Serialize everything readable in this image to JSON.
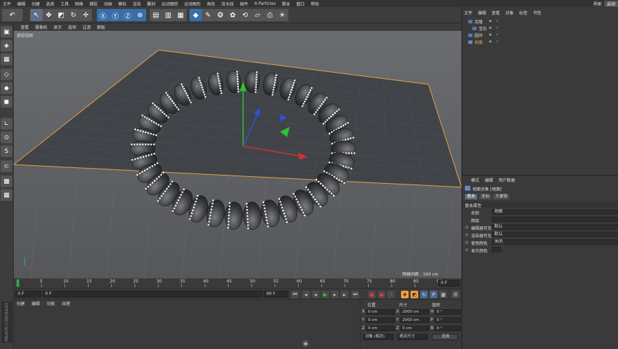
{
  "menubar": {
    "items": [
      "文件",
      "编辑",
      "创建",
      "选择",
      "工具",
      "网格",
      "捕捉",
      "动画",
      "模拟",
      "渲染",
      "雕刻",
      "运动跟踪",
      "运动图形",
      "角色",
      "流水线",
      "插件",
      "X-Particles",
      "脚本",
      "窗口",
      "帮助"
    ],
    "layout_label": "界面",
    "layout_value": "启动"
  },
  "viewport": {
    "menu": [
      "查看",
      "摄像机",
      "显示",
      "选项",
      "过滤",
      "面板"
    ],
    "view_label": "透视视图",
    "grid_spacing": "网格间距 : 100 cm"
  },
  "timeline": {
    "ticks": [
      "0",
      "5",
      "10",
      "15",
      "20",
      "25",
      "30",
      "35",
      "40",
      "45",
      "50",
      "55",
      "60",
      "65",
      "70",
      "75",
      "80",
      "85",
      "90"
    ],
    "end_frame": "0 F"
  },
  "transport": {
    "current_frame": "0 F",
    "min_frame": "0 F",
    "max_frame_field": "90 F",
    "end_frame": "90 F"
  },
  "materials": {
    "menu": [
      "创建",
      "编辑",
      "功能",
      "纹理"
    ]
  },
  "coords": {
    "headers": [
      "位置",
      "尺寸",
      "旋转"
    ],
    "rows": [
      {
        "axis": "X",
        "pos": "0 cm",
        "size_axis": "X",
        "size": "2000 cm",
        "rot_axis": "H",
        "rot": "0 °"
      },
      {
        "axis": "Y",
        "pos": "0 cm",
        "size_axis": "Y",
        "size": "2000 cm",
        "rot_axis": "P",
        "rot": "0 °"
      },
      {
        "axis": "Z",
        "pos": "0 cm",
        "size_axis": "Z",
        "size": "0 cm",
        "rot_axis": "B",
        "rot": "0 °"
      }
    ],
    "mode_select": "对象 (相对)",
    "size_select": "绝对尺寸",
    "apply_label": "应用"
  },
  "objects": {
    "menu": [
      "文件",
      "编辑",
      "查看",
      "对象",
      "标签",
      "书签"
    ],
    "items": [
      {
        "name": "克隆",
        "color": "#dcdcdc"
      },
      {
        "name": "宝石",
        "color": "#dcdcdc"
      },
      {
        "name": "圆环",
        "color": "#dcdcdc"
      },
      {
        "name": "地面",
        "color": "#f0a040"
      }
    ]
  },
  "attributes": {
    "menu": [
      "模式",
      "编辑",
      "用户数据"
    ],
    "object_title": "地面对象 [地面]",
    "tabs": [
      "基本",
      "坐标",
      "方便锁"
    ],
    "section": "基本属性",
    "rows": [
      {
        "label": "名称",
        "value": "地面"
      },
      {
        "label": "图层",
        "value": ""
      },
      {
        "label": "编辑器可见",
        "value": "默认"
      },
      {
        "label": "渲染器可见",
        "value": "默认"
      },
      {
        "label": "使用颜色",
        "value": "关闭"
      },
      {
        "label": "显示颜色",
        "value": ""
      }
    ]
  },
  "colors": {
    "accent": "#f0a040",
    "axis_x": "#d03030",
    "axis_y": "#30c030",
    "axis_z": "#3050e0"
  }
}
